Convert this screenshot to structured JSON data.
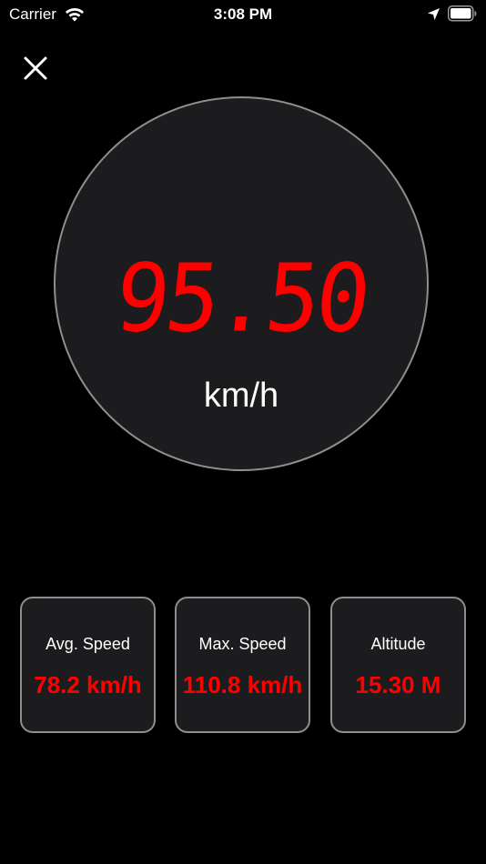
{
  "status_bar": {
    "carrier": "Carrier",
    "time": "3:08 PM",
    "icons": [
      "wifi-icon",
      "location-arrow-icon",
      "battery-icon"
    ]
  },
  "close_icon": "close-icon",
  "speedometer": {
    "value": "95.50",
    "unit": "km/h",
    "value_color": "#ff0000"
  },
  "stats": [
    {
      "label": "Avg. Speed",
      "value": "78.2 km/h"
    },
    {
      "label": "Max. Speed",
      "value": "110.8 km/h"
    },
    {
      "label": "Altitude",
      "value": "15.30 M"
    }
  ],
  "colors": {
    "background": "#000000",
    "panel": "#1c1c1e",
    "border": "#8e8e8e",
    "accent": "#ff0000",
    "text": "#ffffff"
  }
}
